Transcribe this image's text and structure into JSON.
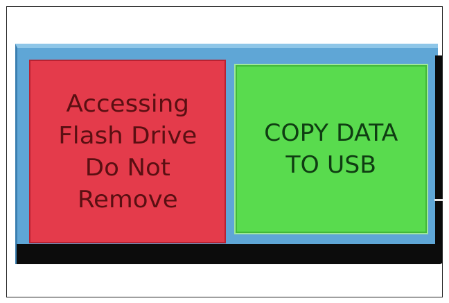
{
  "status_panel": {
    "lines": [
      "Accessing",
      "Flash Drive",
      "Do Not",
      "Remove"
    ]
  },
  "copy_button": {
    "lines": [
      "COPY DATA",
      "TO USB"
    ]
  },
  "colors": {
    "status_red": "#e43b4b",
    "button_green": "#59db4e",
    "panel_blue": "#5fa6d6"
  }
}
